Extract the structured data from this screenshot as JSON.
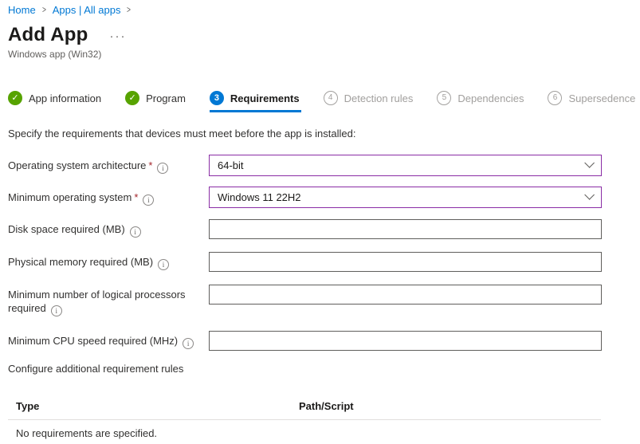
{
  "colors": {
    "link_blue": "#0078d4",
    "active_step_blue": "#0078d4",
    "completed_green": "#57a300",
    "modified_field_purple": "#8a2da5",
    "required_red": "#a4262c",
    "text": "#323130",
    "muted": "#605e5c",
    "disabled_gray": "#a19f9d"
  },
  "breadcrumb": {
    "items": [
      "Home",
      "Apps | All apps"
    ],
    "separator": ">"
  },
  "header": {
    "title": "Add App",
    "more_icon": "···",
    "subtitle": "Windows app (Win32)"
  },
  "wizard": {
    "steps": [
      {
        "label": "App information",
        "state": "completed"
      },
      {
        "label": "Program",
        "state": "completed"
      },
      {
        "number": "3",
        "label": "Requirements",
        "state": "active"
      },
      {
        "number": "4",
        "label": "Detection rules",
        "state": "upcoming"
      },
      {
        "number": "5",
        "label": "Dependencies",
        "state": "upcoming"
      },
      {
        "number": "6",
        "label": "Supersedence",
        "state": "upcoming"
      }
    ]
  },
  "intro": "Specify the requirements that devices must meet before the app is installed:",
  "required_marker": "*",
  "form": {
    "fields": [
      {
        "label": "Operating system architecture",
        "required": true,
        "control": "dropdown",
        "value": "64-bit"
      },
      {
        "label": "Minimum operating system",
        "required": true,
        "control": "dropdown",
        "value": "Windows 11 22H2"
      },
      {
        "label": "Disk space required (MB)",
        "required": false,
        "control": "text",
        "value": ""
      },
      {
        "label": "Physical memory required (MB)",
        "required": false,
        "control": "text",
        "value": ""
      },
      {
        "label": "Minimum number of logical processors required",
        "required": false,
        "control": "text",
        "value": ""
      },
      {
        "label": "Minimum CPU speed required (MHz)",
        "required": false,
        "control": "text",
        "value": ""
      }
    ]
  },
  "rules": {
    "heading": "Configure additional requirement rules",
    "table": {
      "columns": [
        "Type",
        "Path/Script"
      ],
      "empty_message": "No requirements are specified."
    }
  }
}
